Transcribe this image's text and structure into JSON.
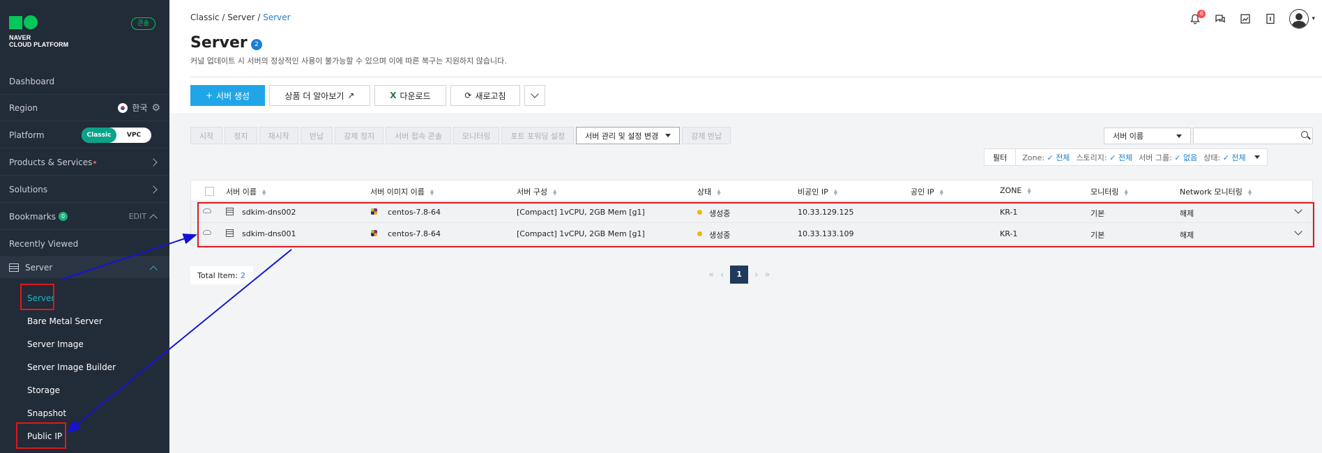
{
  "sidebar": {
    "logo_line1": "NAVER",
    "logo_line2": "CLOUD PLATFORM",
    "console_badge": "콘솔",
    "dashboard": "Dashboard",
    "region_label": "Region",
    "region_value": "한국",
    "platform_label": "Platform",
    "platform_options": [
      "Classic",
      "VPC"
    ],
    "products": "Products & Services",
    "solutions": "Solutions",
    "bookmarks": "Bookmarks",
    "bookmarks_count": "0",
    "edit": "EDIT",
    "recently_viewed": "Recently Viewed",
    "server_group": "Server",
    "sub_items": [
      "Server",
      "Bare Metal Server",
      "Server Image",
      "Server Image Builder",
      "Storage",
      "Snapshot",
      "Public IP"
    ]
  },
  "header": {
    "breadcrumb": [
      "Classic /",
      "Server /",
      "Server"
    ],
    "notification_count": "6",
    "title": "Server",
    "title_count": "2",
    "description": "커널 업데이트 시 서버의 정상적인 사용이 불가능할 수 있으며 이에 따른 복구는 지원하지 않습니다."
  },
  "actions": {
    "create": "서버 생성",
    "learn_more": "상품 더 알아보기",
    "download": "다운로드",
    "refresh": "새로고침"
  },
  "toolbar": {
    "buttons": [
      "시작",
      "정지",
      "재시작",
      "반납",
      "강제 정지",
      "서버 접속 콘솔",
      "모니터링",
      "포트 포워딩 설정"
    ],
    "manage": "서버 관리 및 설정 변경",
    "force_return": "강제 반납"
  },
  "search": {
    "select_value": "서버 이름",
    "input_value": ""
  },
  "filter": {
    "button": "필터",
    "zone_label": "Zone:",
    "zone_value": "전체",
    "storage_label": "스토리지:",
    "storage_value": "전체",
    "group_label": "서버 그룹:",
    "group_value": "없음",
    "status_label": "상태:",
    "status_value": "전체"
  },
  "table": {
    "columns": [
      "서버 이름",
      "서버 이미지 이름",
      "서버 구성",
      "상태",
      "비공인 IP",
      "공인 IP",
      "ZONE",
      "모니터링",
      "Network 모니터링"
    ],
    "rows": [
      {
        "name": "sdkim-dns002",
        "image": "centos-7.8-64",
        "spec": "[Compact] 1vCPU, 2GB Mem [g1]",
        "status": "생성중",
        "private_ip": "10.33.129.125",
        "public_ip": "",
        "zone": "KR-1",
        "monitoring": "기본",
        "net_monitoring": "해제"
      },
      {
        "name": "sdkim-dns001",
        "image": "centos-7.8-64",
        "spec": "[Compact] 1vCPU, 2GB Mem [g1]",
        "status": "생성중",
        "private_ip": "10.33.133.109",
        "public_ip": "",
        "zone": "KR-1",
        "monitoring": "기본",
        "net_monitoring": "해제"
      }
    ]
  },
  "footer": {
    "total_label": "Total Item:",
    "total_value": "2",
    "current_page": "1"
  },
  "colors": {
    "sidebar_bg": "#222b38",
    "accent_teal": "#1fb7c4",
    "primary_blue": "#20a6e8",
    "highlight_red": "#e0171f",
    "arrow_blue": "#1212d8",
    "status_yellow": "#f0b400"
  }
}
